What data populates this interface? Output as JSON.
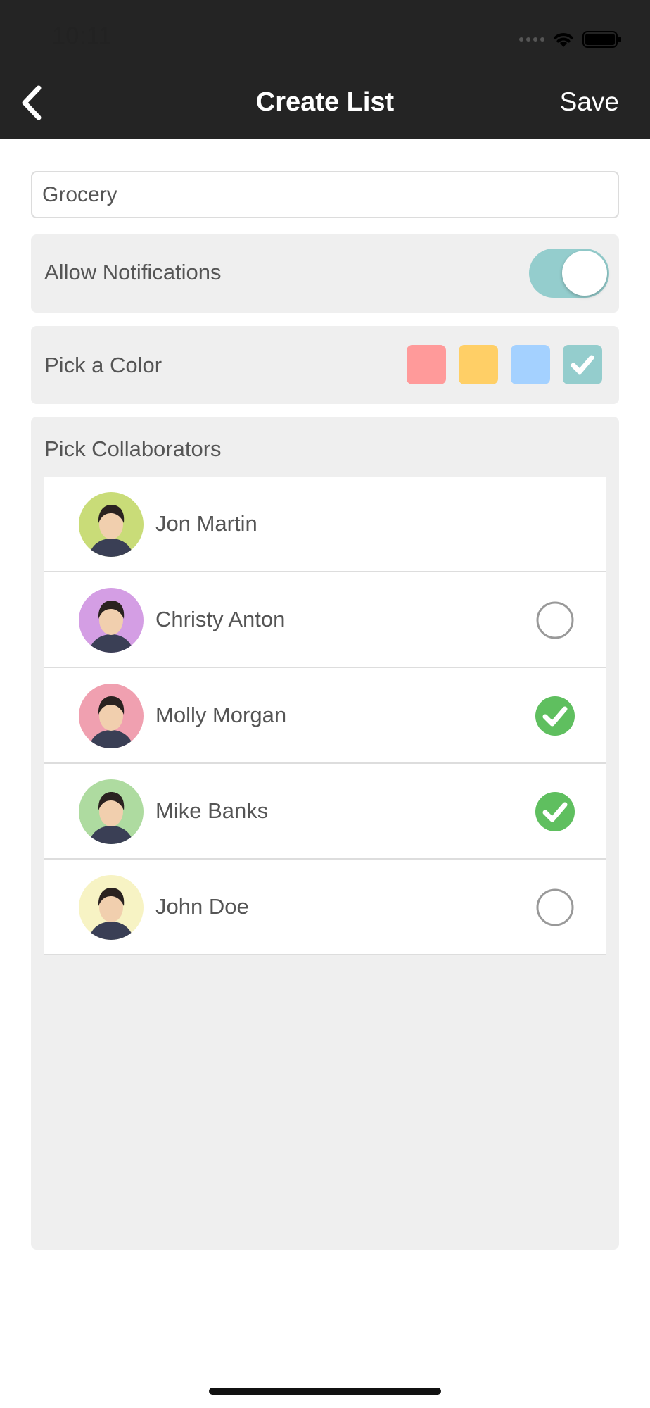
{
  "status_bar": {
    "time": "10:11"
  },
  "nav": {
    "title": "Create List",
    "save_label": "Save"
  },
  "list_name": {
    "value": "Grocery"
  },
  "notifications": {
    "label": "Allow Notifications",
    "enabled": true,
    "toggle_color": "#94cdcd"
  },
  "color_picker": {
    "label": "Pick a Color",
    "options": [
      {
        "color": "#ff9a9a",
        "selected": false
      },
      {
        "color": "#ffcf66",
        "selected": false
      },
      {
        "color": "#a4d1ff",
        "selected": false
      },
      {
        "color": "#94cdcd",
        "selected": true
      }
    ]
  },
  "collaborators": {
    "label": "Pick Collaborators",
    "items": [
      {
        "name": "Jon Martin",
        "selected": null,
        "avatar_bg": "#c9dc78"
      },
      {
        "name": "Christy Anton",
        "selected": false,
        "avatar_bg": "#d49ee4"
      },
      {
        "name": "Molly Morgan",
        "selected": true,
        "avatar_bg": "#f0a0b0"
      },
      {
        "name": "Mike Banks",
        "selected": true,
        "avatar_bg": "#aedba0"
      },
      {
        "name": "John Doe",
        "selected": false,
        "avatar_bg": "#f7f3c4"
      }
    ],
    "check_color": "#5fbf5f"
  }
}
